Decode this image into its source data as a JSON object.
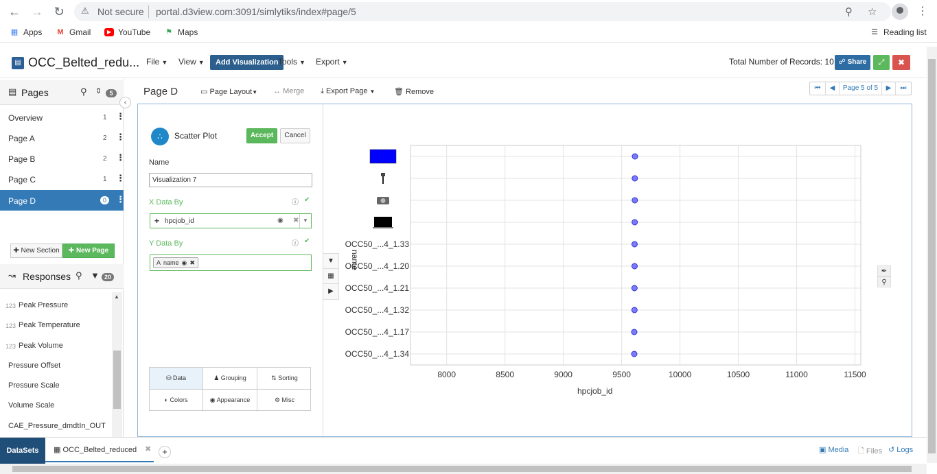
{
  "browser": {
    "not_secure": "Not secure",
    "url": "portal.d3view.com:3091/simlytiks/index#page/5",
    "bookmarks": [
      {
        "label": "Apps",
        "icon": "apps-grid-icon"
      },
      {
        "label": "Gmail",
        "icon": "gmail-icon"
      },
      {
        "label": "YouTube",
        "icon": "youtube-icon"
      },
      {
        "label": "Maps",
        "icon": "maps-icon"
      }
    ],
    "reading_list": "Reading list"
  },
  "app": {
    "title": "OCC_Belted_redu...",
    "menus": {
      "file": "File",
      "view": "View",
      "tools": "Tools",
      "export": "Export"
    },
    "add_visualization": "Add Visualization",
    "records_label": "Total Number of Records: 10",
    "share": "Share"
  },
  "sidebar": {
    "pages_title": "Pages",
    "pages_count": "5",
    "pages": [
      {
        "label": "Overview",
        "count": "1"
      },
      {
        "label": "Page A",
        "count": "2"
      },
      {
        "label": "Page B",
        "count": "2"
      },
      {
        "label": "Page C",
        "count": "1"
      },
      {
        "label": "Page D",
        "count": "0"
      }
    ],
    "new_section": "New Section",
    "new_page": "New Page",
    "responses_title": "Responses",
    "responses_count": "20",
    "responses": [
      {
        "prefix": "123",
        "label": "Peak Pressure"
      },
      {
        "prefix": "123",
        "label": "Peak Temperature"
      },
      {
        "prefix": "123",
        "label": "Peak Volume"
      },
      {
        "prefix": "",
        "label": "Pressure Offset"
      },
      {
        "prefix": "",
        "label": "Pressure Scale"
      },
      {
        "prefix": "",
        "label": "Volume Scale"
      },
      {
        "prefix": "",
        "label": "CAE_Pressure_dmdtIn_OUT"
      }
    ]
  },
  "page_toolbar": {
    "title": "Page D",
    "page_layout": "Page Layout",
    "merge": "Merge",
    "export_page": "Export Page",
    "remove": "Remove",
    "pager": "Page 5 of 5"
  },
  "editor": {
    "viz_type": "Scatter Plot",
    "accept": "Accept",
    "cancel": "Cancel",
    "name_label": "Name",
    "name_value": "Visualization 7",
    "x_label": "X Data By",
    "x_value": "hpcjob_id",
    "y_label": "Y Data By",
    "y_value": "name",
    "tabs": [
      "Data",
      "Grouping",
      "Sorting",
      "Colors",
      "Appearance",
      "Misc"
    ]
  },
  "chart_data": {
    "type": "scatter",
    "xlabel": "hpcjob_id",
    "ylabel": "name",
    "xlim": [
      7690,
      11550
    ],
    "xticks": [
      8000,
      8500,
      9000,
      9500,
      10000,
      10500,
      11000,
      11500
    ],
    "categories": [
      "OCC50_...4_1.34",
      "OCC50_...4_1.17",
      "OCC50_...4_1.32",
      "OCC50_...4_1.21",
      "OCC50_...4_1.20",
      "OCC50_...4_1.33",
      "",
      "",
      "",
      ""
    ],
    "points": [
      {
        "x": 9608,
        "y": "OCC50_...4_1.34"
      },
      {
        "x": 9608,
        "y": "OCC50_...4_1.17"
      },
      {
        "x": 9610,
        "y": "OCC50_...4_1.32"
      },
      {
        "x": 9610,
        "y": "OCC50_...4_1.21"
      },
      {
        "x": 9611,
        "y": "OCC50_...4_1.20"
      },
      {
        "x": 9611,
        "y": "OCC50_...4_1.33"
      },
      {
        "x": 9612,
        "y": "image-category-4"
      },
      {
        "x": 9613,
        "y": "image-category-3"
      },
      {
        "x": 9613,
        "y": "image-category-2"
      },
      {
        "x": 9614,
        "y": "image-category-1"
      }
    ],
    "image_categories": [
      "blue-rectangle-image",
      "tripod-image",
      "camera-image",
      "laptop-image"
    ],
    "point_color": "#7b7bff",
    "grid": true
  },
  "bottom": {
    "datasets": "DataSets",
    "dataset_tab": "OCC_Belted_reduced",
    "media": "Media",
    "files": "Files",
    "logs": "Logs"
  }
}
